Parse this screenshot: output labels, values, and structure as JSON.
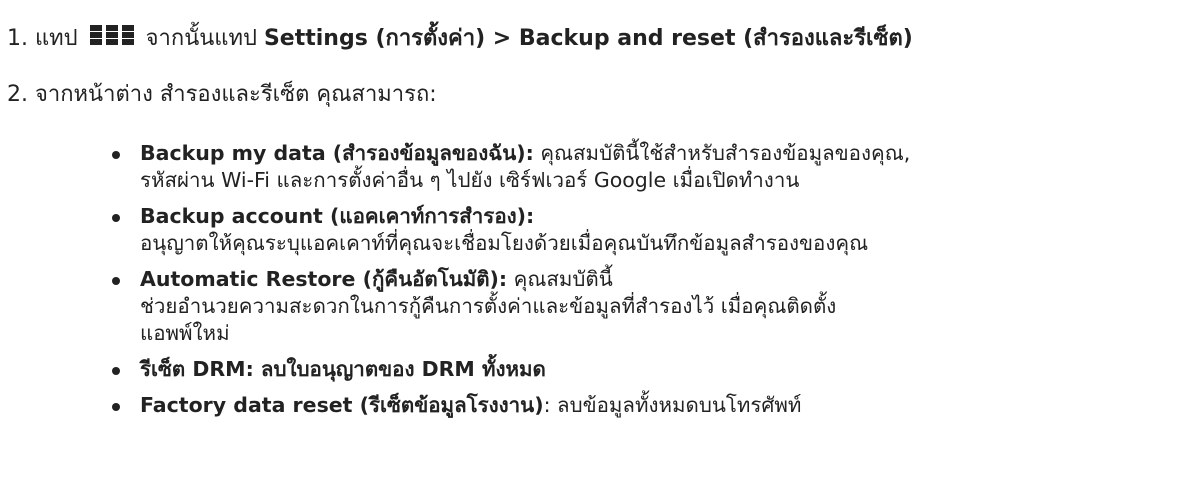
{
  "step1": {
    "prefix": "1. แทป",
    "apps_icon": "apps-grid-icon",
    "middle": "จากนั้นแทป",
    "path": "Settings (การตั้งค่า) > Backup and reset (สำรองและรีเซ็ต)"
  },
  "step2": {
    "text": "2. จากหน้าต่าง สำรองและรีเซ็ต คุณสามารถ:"
  },
  "options": [
    {
      "title": "Backup my data (สำรองข้อมูลของฉัน):",
      "line1": " คุณสมบัตินี้ใช้สำหรับสำรองข้อมูลของคุณ,",
      "line2": "รหัสผ่าน Wi-Fi และการตั้งค่าอื่น ๆ ไปยัง เซิร์ฟเวอร์ Google เมื่อเปิดทำงาน"
    },
    {
      "title": "Backup account (แอคเคาท์การสำรอง):",
      "line1": "",
      "line2": "อนุญาตให้คุณระบุแอคเคาท์ที่คุณจะเชื่อมโยงด้วยเมื่อคุณบันทึกข้อมูลสำรองของคุณ"
    },
    {
      "title": "Automatic Restore (กู้คืนอัตโนมัติ):",
      "line1": " คุณสมบัตินี้",
      "line2": "ช่วยอำนวยความสะดวกในการกู้คืนการตั้งค่าและข้อมูลที่สำรองไว้ เมื่อคุณติดตั้ง",
      "line3": "แอพพ์ใหม่"
    },
    {
      "title": "รีเซ็ต DRM: ลบใบอนุญาตของ DRM ทั้งหมด",
      "line1": ""
    },
    {
      "title": "Factory data reset (รีเซ็ตข้อมูลโรงงาน)",
      "line1": ":  ลบข้อมูลทั้งหมดบนโทรศัพท์"
    }
  ]
}
